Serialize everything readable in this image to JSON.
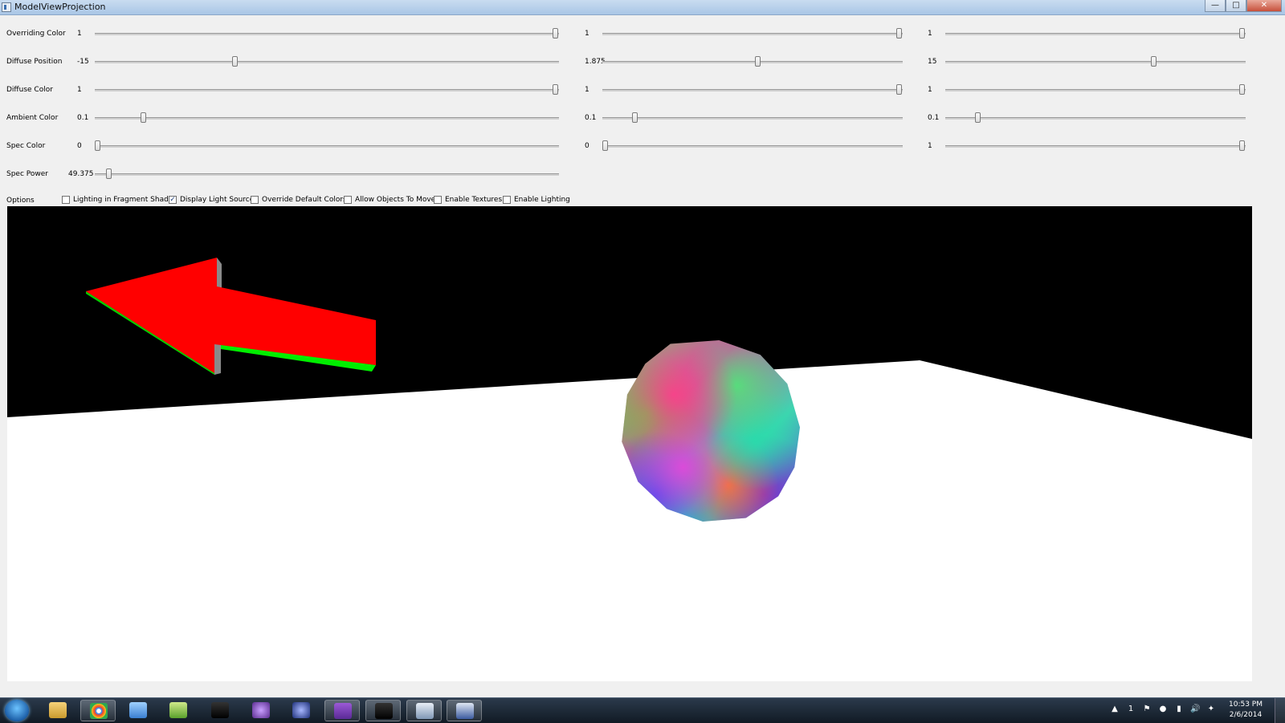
{
  "window": {
    "title": "ModelViewProjection",
    "controls": [
      "—",
      "□",
      "✕"
    ]
  },
  "rows": [
    {
      "label": "Overriding Color",
      "values": [
        "1",
        "1",
        "1"
      ],
      "positions": [
        1,
        1,
        1
      ]
    },
    {
      "label": "Diffuse Position",
      "values": [
        "-15",
        "1.875",
        "15"
      ],
      "positions": [
        0.3,
        0.52,
        0.7
      ]
    },
    {
      "label": "Diffuse Color",
      "values": [
        "1",
        "1",
        "1"
      ],
      "positions": [
        1,
        1,
        1
      ]
    },
    {
      "label": "Ambient Color",
      "values": [
        "0.1",
        "0.1",
        "0.1"
      ],
      "positions": [
        0.1,
        0.1,
        0.1
      ]
    },
    {
      "label": "Spec Color",
      "values": [
        "0",
        "0",
        "1"
      ],
      "positions": [
        0,
        0,
        1
      ]
    },
    {
      "label": "Spec Power",
      "values": [
        "49.375"
      ],
      "positions": [
        0.025
      ]
    }
  ],
  "options": {
    "label": "Options",
    "items": [
      {
        "label": "Lighting in Fragment Shader",
        "checked": false
      },
      {
        "label": "Display Light Source",
        "checked": true
      },
      {
        "label": "Override Default Colors",
        "checked": false
      },
      {
        "label": "Allow Objects To Move",
        "checked": false
      },
      {
        "label": "Enable Textures",
        "checked": false
      },
      {
        "label": "Enable Lighting",
        "checked": false
      }
    ]
  },
  "scene": {
    "background": "#000000",
    "floor_color": "#ffffff",
    "arrow_color": "#ff0000",
    "arrow_edge_color": "#00ff00",
    "arrow_side_color": "#8a8a8a"
  },
  "taskbar": {
    "apps": [
      "start-orb",
      "explorer",
      "chrome",
      "notepad",
      "spreadsheet",
      "console",
      "eclipse-purple",
      "eclipse-blue",
      "visual-studio",
      "console-2",
      "window-app",
      "paint-app"
    ],
    "time": "10:53 PM",
    "date": "2/6/2014",
    "tray": [
      "▲",
      "1",
      "⚑",
      "●",
      "▮",
      "🔊",
      "✦"
    ]
  }
}
